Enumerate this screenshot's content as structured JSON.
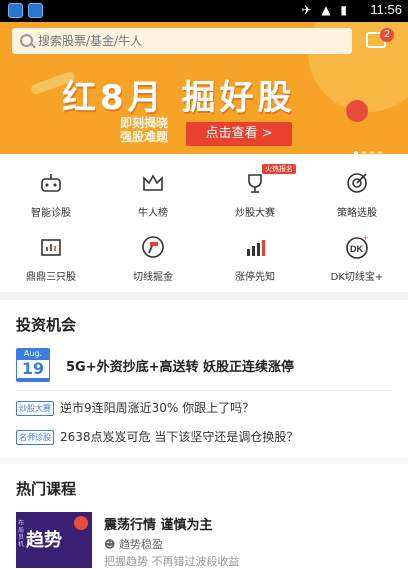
{
  "status_bar": {
    "time": "11:56",
    "icons": "✈ ▲ ▮"
  },
  "search": {
    "placeholder": "搜索股票/基金/牛人"
  },
  "message_badge": "2",
  "banner": {
    "title": "红8月 掘好股",
    "subtitle": "即刻揭晓 强股难题",
    "button": "点击查看 >",
    "page_count": 4,
    "active_page": 1
  },
  "shortcuts": [
    {
      "label": "智能诊股",
      "icon": "robot-icon"
    },
    {
      "label": "牛人榜",
      "icon": "crown-icon"
    },
    {
      "label": "炒股大赛",
      "icon": "trophy-icon",
      "badge": "火热报名"
    },
    {
      "label": "策略选股",
      "icon": "target-icon"
    },
    {
      "label": "鼎鼎三只股",
      "icon": "chart-box-icon"
    },
    {
      "label": "切线掘金",
      "icon": "hammer-icon"
    },
    {
      "label": "涨停先知",
      "icon": "bars-up-icon"
    },
    {
      "label": "DK切线宝+",
      "icon": "dk-icon"
    }
  ],
  "opportunities": {
    "heading": "投资机会",
    "date": {
      "month": "Aug.",
      "day": "19"
    },
    "headline": "5G+外资抄底+高送转 妖股正连续涨停",
    "items": [
      {
        "tag": "炒股大赛",
        "text": "逆市9连阳周涨近30% 你跟上了吗？"
      },
      {
        "tag": "名师诊股",
        "text": "2638点岌岌可危 当下该坚守还是调仓换股？"
      }
    ]
  },
  "courses": {
    "heading": "热门课程",
    "items": [
      {
        "image_text": "趋势",
        "image_side": "布局良机",
        "title": "震荡行情 谨慎为主",
        "author": "趋势稳盈",
        "desc": "把握趋势 不再错过波段收益"
      }
    ]
  }
}
